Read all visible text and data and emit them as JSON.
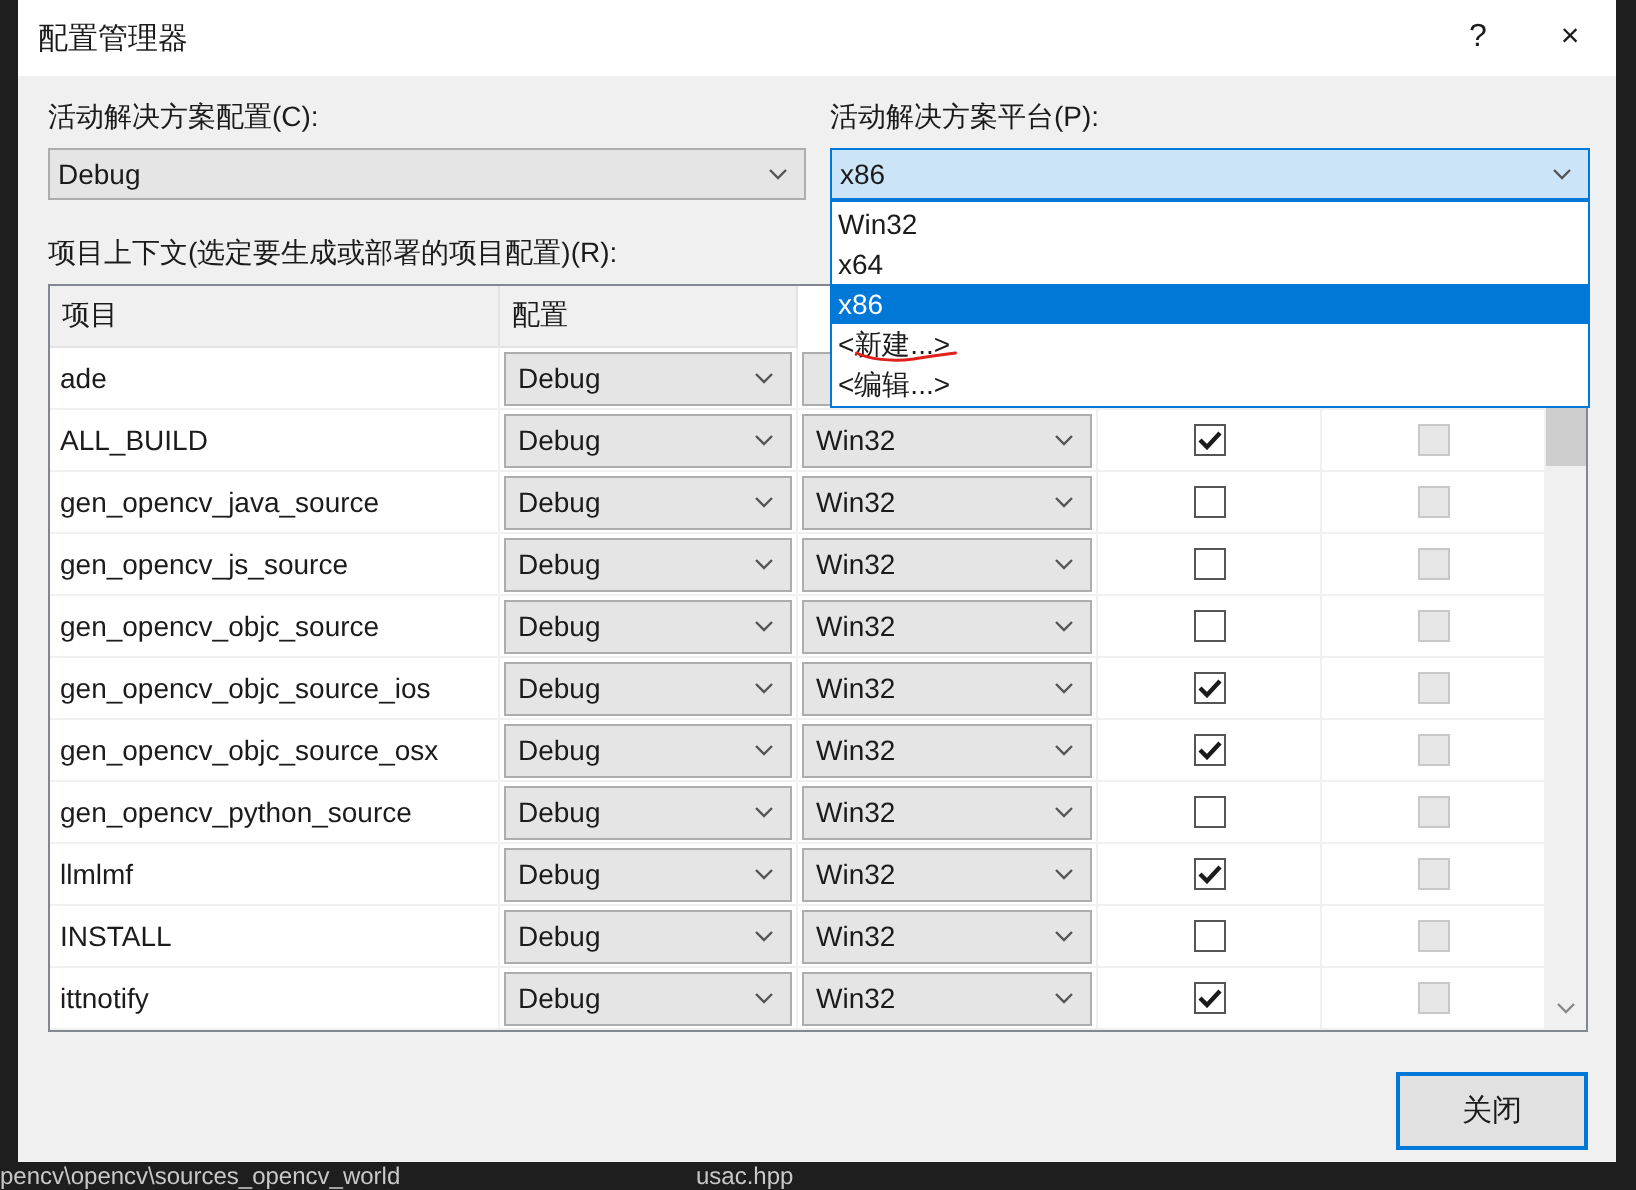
{
  "window": {
    "title": "配置管理器",
    "help": "?",
    "close": "×"
  },
  "solution_config": {
    "label": "活动解决方案配置(C):",
    "value": "Debug"
  },
  "solution_platform": {
    "label": "活动解决方案平台(P):",
    "value": "x86",
    "expanded": true,
    "options": [
      {
        "label": "Win32",
        "selected": false
      },
      {
        "label": "x64",
        "selected": false
      },
      {
        "label": "x86",
        "selected": true
      },
      {
        "label": "<新建...>",
        "selected": false
      },
      {
        "label": "<编辑...>",
        "selected": false
      }
    ]
  },
  "context_label": "项目上下文(选定要生成或部署的项目配置)(R):",
  "table": {
    "columns": [
      "项目",
      "配置"
    ],
    "rows": [
      {
        "project": "ade",
        "config": "Debug"
      },
      {
        "project": "ALL_BUILD",
        "config": "Debug",
        "platform": "Win32",
        "build": {
          "checked": true
        },
        "deploy": {
          "checked": false,
          "disabled": true
        }
      },
      {
        "project": "gen_opencv_java_source",
        "config": "Debug",
        "platform": "Win32",
        "build": {
          "checked": false
        },
        "deploy": {
          "checked": false,
          "disabled": true
        }
      },
      {
        "project": "gen_opencv_js_source",
        "config": "Debug",
        "platform": "Win32",
        "build": {
          "checked": false
        },
        "deploy": {
          "checked": false,
          "disabled": true
        }
      },
      {
        "project": "gen_opencv_objc_source",
        "config": "Debug",
        "platform": "Win32",
        "build": {
          "checked": false
        },
        "deploy": {
          "checked": false,
          "disabled": true
        }
      },
      {
        "project": "gen_opencv_objc_source_ios",
        "config": "Debug",
        "platform": "Win32",
        "build": {
          "checked": true
        },
        "deploy": {
          "checked": false,
          "disabled": true
        }
      },
      {
        "project": "gen_opencv_objc_source_osx",
        "config": "Debug",
        "platform": "Win32",
        "build": {
          "checked": true
        },
        "deploy": {
          "checked": false,
          "disabled": true
        }
      },
      {
        "project": "gen_opencv_python_source",
        "config": "Debug",
        "platform": "Win32",
        "build": {
          "checked": false
        },
        "deploy": {
          "checked": false,
          "disabled": true
        }
      },
      {
        "project": "llmlmf",
        "config": "Debug",
        "platform": "Win32",
        "build": {
          "checked": true
        },
        "deploy": {
          "checked": false,
          "disabled": true
        }
      },
      {
        "project": "INSTALL",
        "config": "Debug",
        "platform": "Win32",
        "build": {
          "checked": false
        },
        "deploy": {
          "checked": false,
          "disabled": true
        }
      },
      {
        "project": "ittnotify",
        "config": "Debug",
        "platform": "Win32",
        "build": {
          "checked": true
        },
        "deploy": {
          "checked": false,
          "disabled": true
        }
      }
    ]
  },
  "close_button": "关闭",
  "background_status": [
    "pencv\\opencv\\sources_opencv_world",
    "usac.hpp"
  ]
}
